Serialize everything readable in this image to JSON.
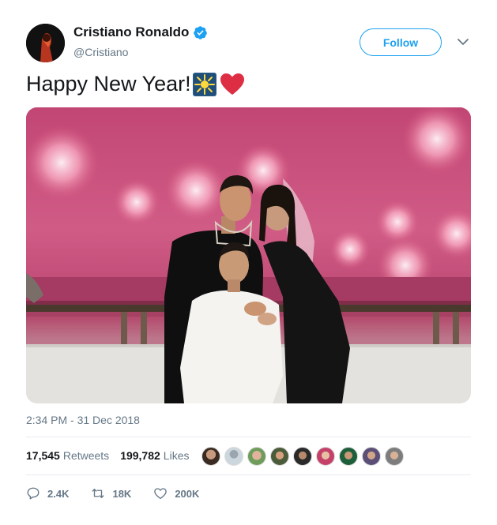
{
  "user": {
    "display_name": "Cristiano Ronaldo",
    "handle": "@Cristiano",
    "verified": true
  },
  "follow_label": "Follow",
  "tweet": {
    "text": "Happy New Year!",
    "emojis": [
      "sparkle-emoji",
      "red-heart-emoji"
    ]
  },
  "timestamp": "2:34 PM - 31 Dec 2018",
  "stats": {
    "retweets_count": "17,545",
    "retweets_label": "Retweets",
    "likes_count": "199,782",
    "likes_label": "Likes"
  },
  "actions": {
    "reply_count": "2.4K",
    "retweet_count": "18K",
    "like_count": "200K"
  },
  "colors": {
    "accent": "#1da1f2",
    "secondary_text": "#657786",
    "heart": "#e0245e"
  }
}
